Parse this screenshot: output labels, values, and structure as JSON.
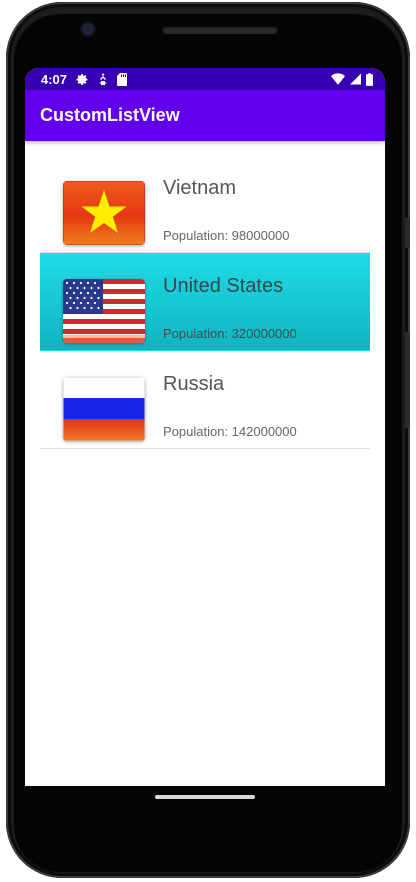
{
  "status_bar": {
    "time": "4:07",
    "left_icons": [
      "settings-icon",
      "debug-icon",
      "sd-card-icon"
    ],
    "right_icons": [
      "wifi-icon",
      "signal-icon",
      "battery-icon"
    ],
    "color": "#3700b3"
  },
  "app_bar": {
    "title": "CustomListView",
    "color": "#6200ee"
  },
  "countries": [
    {
      "name": "Vietnam",
      "population": "Population: 98000000",
      "flag_icon": "vietnam-flag-icon",
      "selected": false
    },
    {
      "name": "United States",
      "population": "Population: 320000000",
      "flag_icon": "usa-flag-icon",
      "selected": true
    },
    {
      "name": "Russia",
      "population": "Population: 142000000",
      "flag_icon": "russia-flag-icon",
      "selected": false
    }
  ],
  "colors": {
    "selected_row": "#1ad0dc",
    "divider": "#e0e0e0"
  }
}
